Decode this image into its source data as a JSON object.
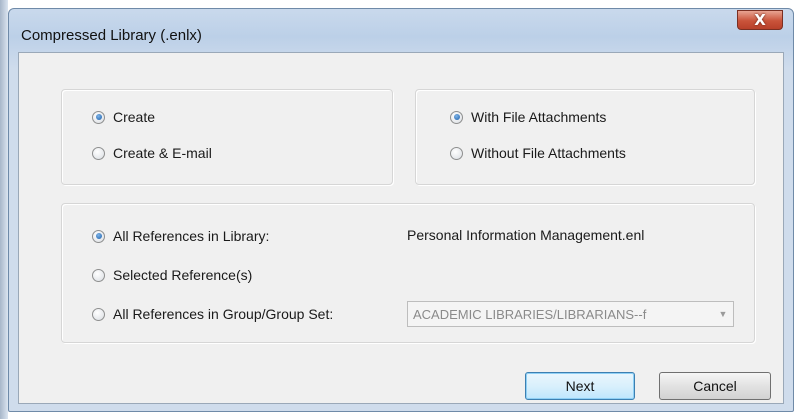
{
  "window": {
    "title": "Compressed Library (.enlx)",
    "close_glyph": "X"
  },
  "mode_group": {
    "options": [
      {
        "label": "Create",
        "checked": true
      },
      {
        "label": "Create & E-mail",
        "checked": false
      }
    ]
  },
  "attachments_group": {
    "options": [
      {
        "label": "With File Attachments",
        "checked": true
      },
      {
        "label": "Without File Attachments",
        "checked": false
      }
    ]
  },
  "references_group": {
    "all_in_library": {
      "label": "All References in Library:",
      "checked": true
    },
    "library_name": "Personal Information Management.enl",
    "selected": {
      "label": "Selected Reference(s)",
      "checked": false
    },
    "in_group": {
      "label": "All References in Group/Group Set:",
      "checked": false
    },
    "group_select": {
      "value": "ACADEMIC LIBRARIES/LIBRARIANS--f",
      "disabled": true
    }
  },
  "buttons": {
    "next": "Next",
    "cancel": "Cancel"
  },
  "colors": {
    "title_bar": "#bcd0e8",
    "client_bg": "#f0f0f0",
    "close_button": "#c9533a",
    "default_button_border": "#3c7fb1"
  },
  "icons": {
    "close": "close-icon",
    "dropdown": "chevron-down-icon"
  }
}
